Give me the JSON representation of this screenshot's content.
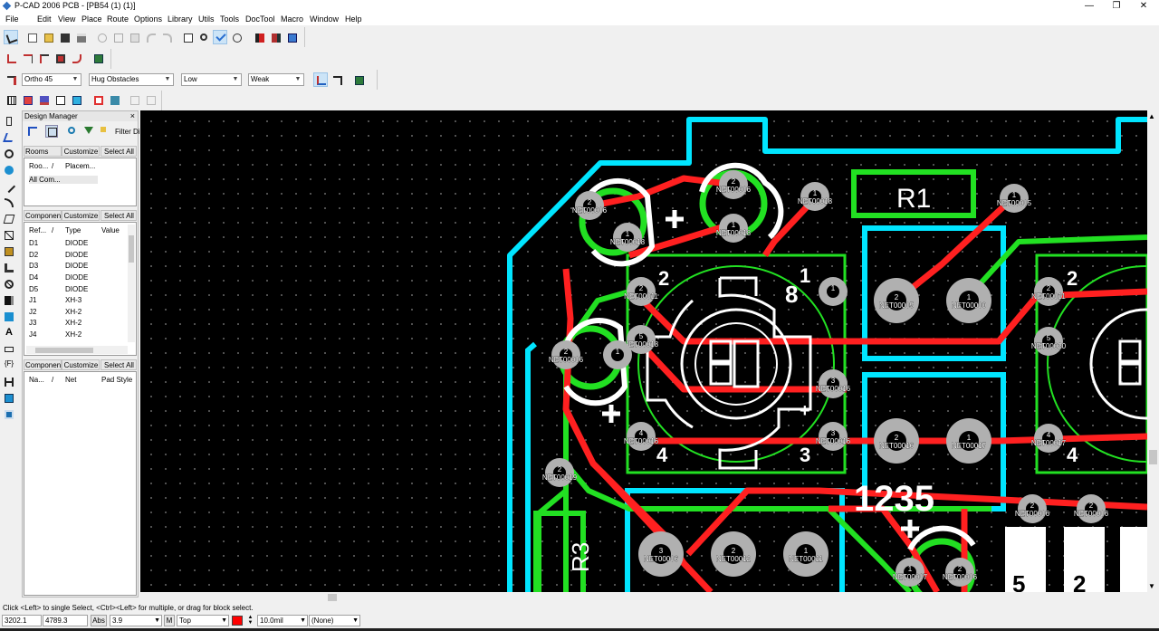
{
  "app": {
    "title": "P-CAD 2006 PCB - [PB54 (1) (1)]"
  },
  "menu": [
    "File",
    "Edit",
    "View",
    "Place",
    "Route",
    "Options",
    "Library",
    "Utils",
    "Tools",
    "DocTool",
    "Macro",
    "Window",
    "Help"
  ],
  "route_toolbar": {
    "mode": "Ortho 45",
    "obstacle": "Hug Obstacles",
    "level": "Low",
    "strength": "Weak"
  },
  "design_manager": {
    "title": "Design Manager",
    "close": "×",
    "filter_label": "Filter Dir",
    "rooms": {
      "tab": "Rooms",
      "customize": "Customize",
      "select_all": "Select All",
      "columns": [
        "Roo...",
        "/",
        "Placem..."
      ],
      "rows": [
        "All Com..."
      ]
    },
    "components": {
      "tab": "Componen",
      "customize": "Customize",
      "select_all": "Select All",
      "columns": [
        "Ref...",
        "/",
        "Type",
        "Value"
      ],
      "rows": [
        {
          "ref": "D1",
          "type": "DIODE"
        },
        {
          "ref": "D2",
          "type": "DIODE"
        },
        {
          "ref": "D3",
          "type": "DIODE"
        },
        {
          "ref": "D4",
          "type": "DIODE"
        },
        {
          "ref": "D5",
          "type": "DIODE"
        },
        {
          "ref": "J1",
          "type": "XH-3"
        },
        {
          "ref": "J2",
          "type": "XH-2"
        },
        {
          "ref": "J3",
          "type": "XH-2"
        },
        {
          "ref": "J4",
          "type": "XH-2"
        }
      ]
    },
    "pins": {
      "tab": "Componen",
      "customize": "Customize",
      "select_all": "Select All",
      "columns": [
        "Na...",
        "/",
        "Net",
        "Pad Style"
      ]
    }
  },
  "pcb": {
    "labels": {
      "r1": "R1",
      "r3": "R3",
      "big": "1235",
      "n2a": "2",
      "n1a": "1",
      "n8": "8",
      "n4a": "4",
      "n3a": "3",
      "n2b": "2",
      "n4b": "4",
      "n5": "5",
      "n2c": "2",
      "plus": "+"
    },
    "pads": [
      {
        "n": "2",
        "net": "NET00006"
      },
      {
        "n": "1",
        "net": "NET00018"
      },
      {
        "n": "2",
        "net": "NET00006"
      },
      {
        "n": "1",
        "net": "NET00018"
      },
      {
        "n": "1",
        "net": "NET00018"
      },
      {
        "n": "1",
        "net": "NET00005"
      },
      {
        "n": "2",
        "net": "NET00011"
      },
      {
        "n": "1",
        "net": ""
      },
      {
        "n": "2",
        "net": "NET00005"
      },
      {
        "n": "1",
        "net": "NET00000"
      },
      {
        "n": "2",
        "net": "NET00011"
      },
      {
        "n": "5",
        "net": "NET00018"
      },
      {
        "n": "2",
        "net": "NET00006"
      },
      {
        "n": "1",
        "net": ""
      },
      {
        "n": "5",
        "net": "NET00020"
      },
      {
        "n": "3",
        "net": "NET00016"
      },
      {
        "n": "4",
        "net": "NET00016"
      },
      {
        "n": "3",
        "net": "NET00016"
      },
      {
        "n": "2",
        "net": "NET00016"
      },
      {
        "n": "1",
        "net": "NET00017"
      },
      {
        "n": "4",
        "net": "NET00017"
      },
      {
        "n": "2",
        "net": "NET00019"
      },
      {
        "n": "3",
        "net": "NET00006"
      },
      {
        "n": "2",
        "net": "NET00012"
      },
      {
        "n": "1",
        "net": "NET00011"
      },
      {
        "n": "1",
        "net": "NET00007"
      },
      {
        "n": "2",
        "net": "NET00006"
      },
      {
        "n": "2",
        "net": "NET00006"
      },
      {
        "n": "2",
        "net": "NET00006"
      }
    ]
  },
  "status": {
    "hint": "Click <Left> to single Select, <Ctrl><Left> for multiple, or drag for block select.",
    "x": "3202.1",
    "y": "4789.3",
    "abs": "Abs",
    "grid": "3.9",
    "m": "M",
    "layer": "Top",
    "layer_color": "#ff0000",
    "width": "10.0mil",
    "style": "(None)"
  },
  "colors": {
    "board_outline": "#00e5ff",
    "top_copper": "#ff2020",
    "bottom_copper": "#22e022",
    "pad": "#b0b0b0",
    "silk": "#ffffff"
  }
}
